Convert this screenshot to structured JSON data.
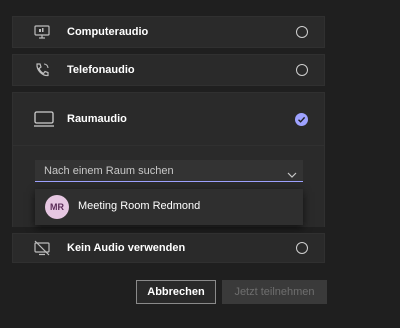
{
  "options": {
    "computer": "Computeraudio",
    "phone": "Telefonaudio",
    "room": "Raumaudio",
    "none": "Kein Audio verwenden"
  },
  "room_search": {
    "placeholder": "Nach einem Raum suchen",
    "results": [
      {
        "initials": "MR",
        "name": "Meeting Room Redmond"
      }
    ]
  },
  "buttons": {
    "cancel": "Abbrechen",
    "join": "Jetzt teilnehmen"
  },
  "colors": {
    "accent": "#9ea2ff",
    "avatar_bg": "#e6c7e2"
  }
}
